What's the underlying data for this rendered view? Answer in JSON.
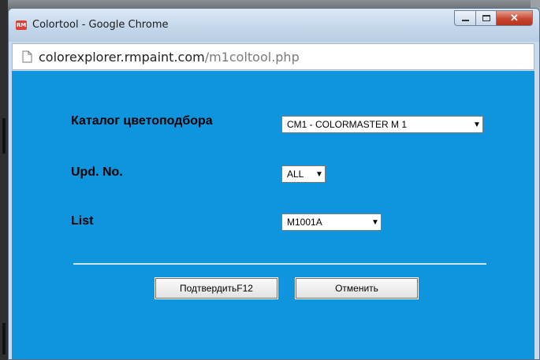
{
  "window": {
    "title": "Colortool - Google Chrome",
    "app_icon_text": "RM",
    "url_host": "colorexplorer.rmpaint.com",
    "url_path": "/m1coltool.php"
  },
  "form": {
    "catalog": {
      "label": "Каталог цветоподбора",
      "value": "CM1 - COLORMASTER M 1"
    },
    "update": {
      "label": "Upd. No.",
      "value": "ALL"
    },
    "list": {
      "label": "List",
      "value": "M1001A"
    }
  },
  "buttons": {
    "confirm": "ПодтвердитьF12",
    "cancel": "Отменить"
  },
  "colors": {
    "content_bg": "#0e95dd",
    "close_button": "#c7462f"
  }
}
